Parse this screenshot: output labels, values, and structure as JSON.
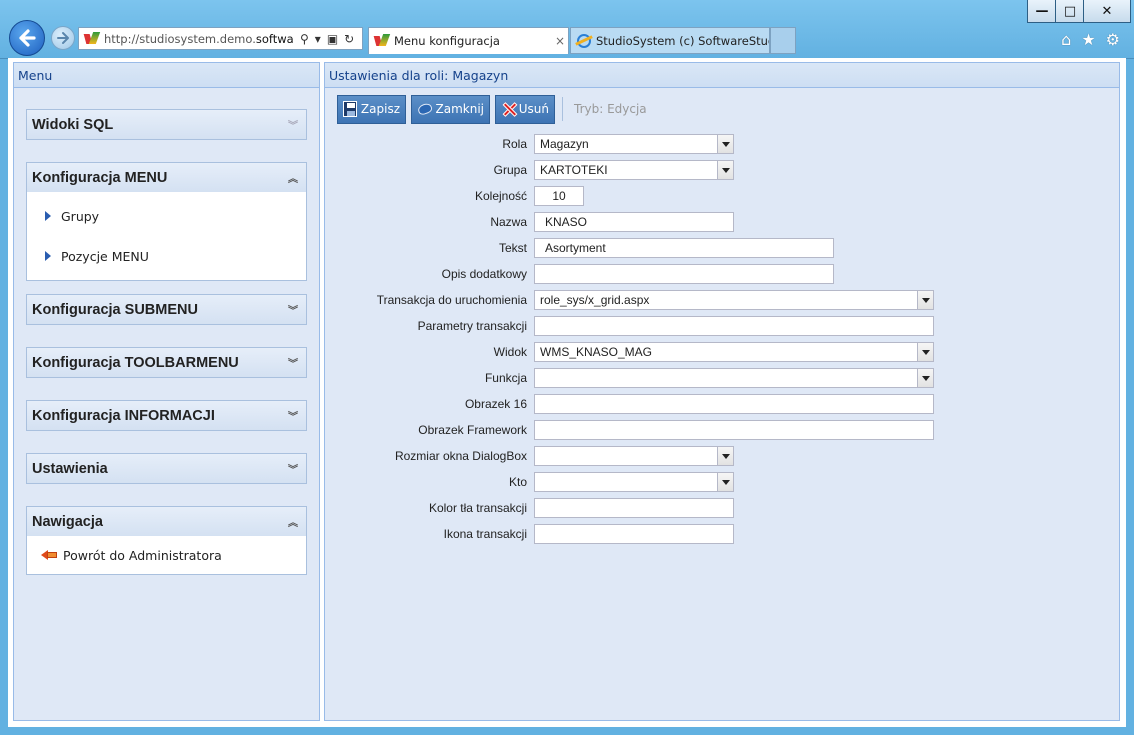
{
  "browser": {
    "url_plain": "http://studiosystem.demo.",
    "url_bold": "softwar...",
    "tabs": [
      {
        "label": "Menu konfiguracja",
        "close": "×"
      },
      {
        "label": "StudioSystem (c) SoftwareStud..."
      }
    ],
    "window_controls": {
      "minimize": "—",
      "maximize": "□",
      "close": "✕"
    },
    "tool_icons": {
      "home": "⌂",
      "favorites": "★",
      "settings": "⚙"
    }
  },
  "left_panel": {
    "title": "Menu",
    "sections": [
      {
        "title": "Widoki SQL",
        "expanded": false,
        "chevron": "»",
        "items": []
      },
      {
        "title": "Konfiguracja MENU",
        "expanded": true,
        "chevron": "«",
        "items": [
          "Grupy",
          "Pozycje MENU"
        ]
      },
      {
        "title": "Konfiguracja SUBMENU",
        "expanded": false,
        "chevron": "»",
        "items": []
      },
      {
        "title": "Konfiguracja TOOLBARMENU",
        "expanded": false,
        "chevron": "»",
        "items": []
      },
      {
        "title": "Konfiguracja INFORMACJI",
        "expanded": false,
        "chevron": "»",
        "items": []
      },
      {
        "title": "Ustawienia",
        "expanded": false,
        "chevron": "»",
        "items": []
      },
      {
        "title": "Nawigacja",
        "expanded": true,
        "chevron": "«",
        "items": [
          "Powrót do Administratora"
        ]
      }
    ]
  },
  "right_panel": {
    "title": "Ustawienia dla roli: Magazyn",
    "toolbar": {
      "save": "Zapisz",
      "close": "Zamknij",
      "delete": "Usuń",
      "mode": "Tryb: Edycja"
    },
    "form": {
      "rola": {
        "label": "Rola",
        "value": "Magazyn"
      },
      "grupa": {
        "label": "Grupa",
        "value": "KARTOTEKI"
      },
      "kolejnosc": {
        "label": "Kolejność",
        "value": "10"
      },
      "nazwa": {
        "label": "Nazwa",
        "value": "KNASO"
      },
      "tekst": {
        "label": "Tekst",
        "value": "Asortyment"
      },
      "opis": {
        "label": "Opis dodatkowy",
        "value": ""
      },
      "transakcja": {
        "label": "Transakcja do uruchomienia",
        "value": "role_sys/x_grid.aspx"
      },
      "parametry": {
        "label": "Parametry transakcji",
        "value": ""
      },
      "widok": {
        "label": "Widok",
        "value": "WMS_KNASO_MAG"
      },
      "funkcja": {
        "label": "Funkcja",
        "value": ""
      },
      "obrazek16": {
        "label": "Obrazek 16",
        "value": ""
      },
      "obrazekfw": {
        "label": "Obrazek Framework",
        "value": ""
      },
      "rozmiar": {
        "label": "Rozmiar okna DialogBox",
        "value": ""
      },
      "kto": {
        "label": "Kto",
        "value": ""
      },
      "kolor": {
        "label": "Kolor tła transakcji",
        "value": ""
      },
      "ikona": {
        "label": "Ikona transakcji",
        "value": ""
      }
    }
  }
}
